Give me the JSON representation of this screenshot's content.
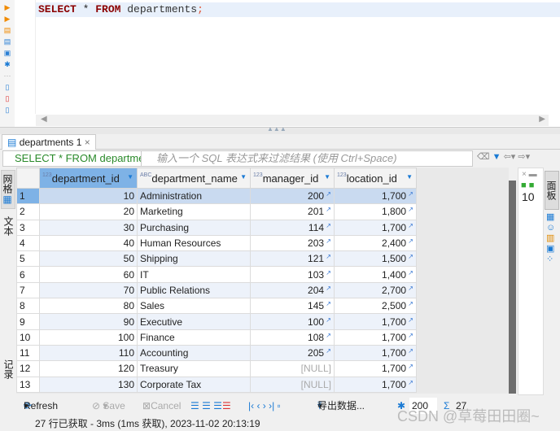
{
  "editor": {
    "sql_keyword_select": "SELECT",
    "sql_star": " * ",
    "sql_keyword_from": "FROM",
    "sql_rest": " departments",
    "sql_semicolon": ";"
  },
  "result_tab": {
    "label": "departments 1",
    "close": "×"
  },
  "filter": {
    "sql": "SELECT * FROM departments",
    "placeholder": "输入一个 SQL 表达式来过滤结果 (使用 Ctrl+Space)"
  },
  "side_tabs": {
    "grid": "网格",
    "text": "文本",
    "record": "记录"
  },
  "right_panel": {
    "tab": "面板",
    "value": "10"
  },
  "columns": [
    {
      "type": "123",
      "label": "department_id"
    },
    {
      "type": "ABC",
      "label": "department_name"
    },
    {
      "type": "123",
      "label": "manager_id"
    },
    {
      "type": "123",
      "label": "location_id"
    }
  ],
  "rows": [
    [
      "1",
      "10",
      "Administration",
      "200",
      "1,700"
    ],
    [
      "2",
      "20",
      "Marketing",
      "201",
      "1,800"
    ],
    [
      "3",
      "30",
      "Purchasing",
      "114",
      "1,700"
    ],
    [
      "4",
      "40",
      "Human Resources",
      "203",
      "2,400"
    ],
    [
      "5",
      "50",
      "Shipping",
      "121",
      "1,500"
    ],
    [
      "6",
      "60",
      "IT",
      "103",
      "1,400"
    ],
    [
      "7",
      "70",
      "Public Relations",
      "204",
      "2,700"
    ],
    [
      "8",
      "80",
      "Sales",
      "145",
      "2,500"
    ],
    [
      "9",
      "90",
      "Executive",
      "100",
      "1,700"
    ],
    [
      "10",
      "100",
      "Finance",
      "108",
      "1,700"
    ],
    [
      "11",
      "110",
      "Accounting",
      "205",
      "1,700"
    ],
    [
      "12",
      "120",
      "Treasury",
      "[NULL]",
      "1,700"
    ],
    [
      "13",
      "130",
      "Corporate Tax",
      "[NULL]",
      "1,700"
    ]
  ],
  "bottom_toolbar": {
    "refresh": "Refresh",
    "save": "Save",
    "cancel": "Cancel",
    "export": "导出数据...",
    "fetch_size": "200",
    "row_count": "27"
  },
  "status": "27 行已获取 - 3ms (1ms 获取), 2023-11-02 20:13:19",
  "watermark": "CSDN @草莓田田圈~"
}
